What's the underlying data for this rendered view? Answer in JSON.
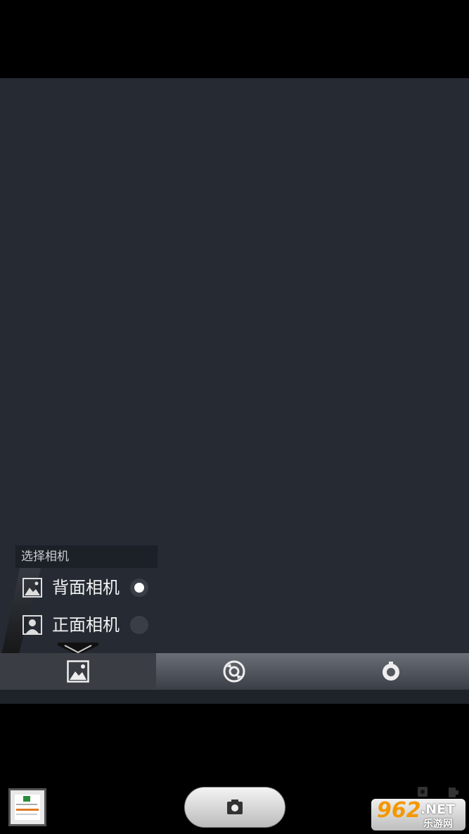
{
  "camera_picker": {
    "title": "选择相机",
    "options": [
      {
        "label": "背面相机",
        "selected": true,
        "icon": "landscape-icon"
      },
      {
        "label": "正面相机",
        "selected": false,
        "icon": "portrait-icon"
      }
    ]
  },
  "tabs": [
    {
      "name": "camera-select",
      "icon": "landscape-icon",
      "active": true
    },
    {
      "name": "camera-mode",
      "icon": "rotate-camera-icon",
      "active": false
    },
    {
      "name": "timer",
      "icon": "timer-icon",
      "active": false
    }
  ],
  "watermark": {
    "brand": "962",
    "suffix": ".NET",
    "subtitle": "乐游网"
  },
  "colors": {
    "viewfinder": "#252a33",
    "accent": "#f39800"
  }
}
